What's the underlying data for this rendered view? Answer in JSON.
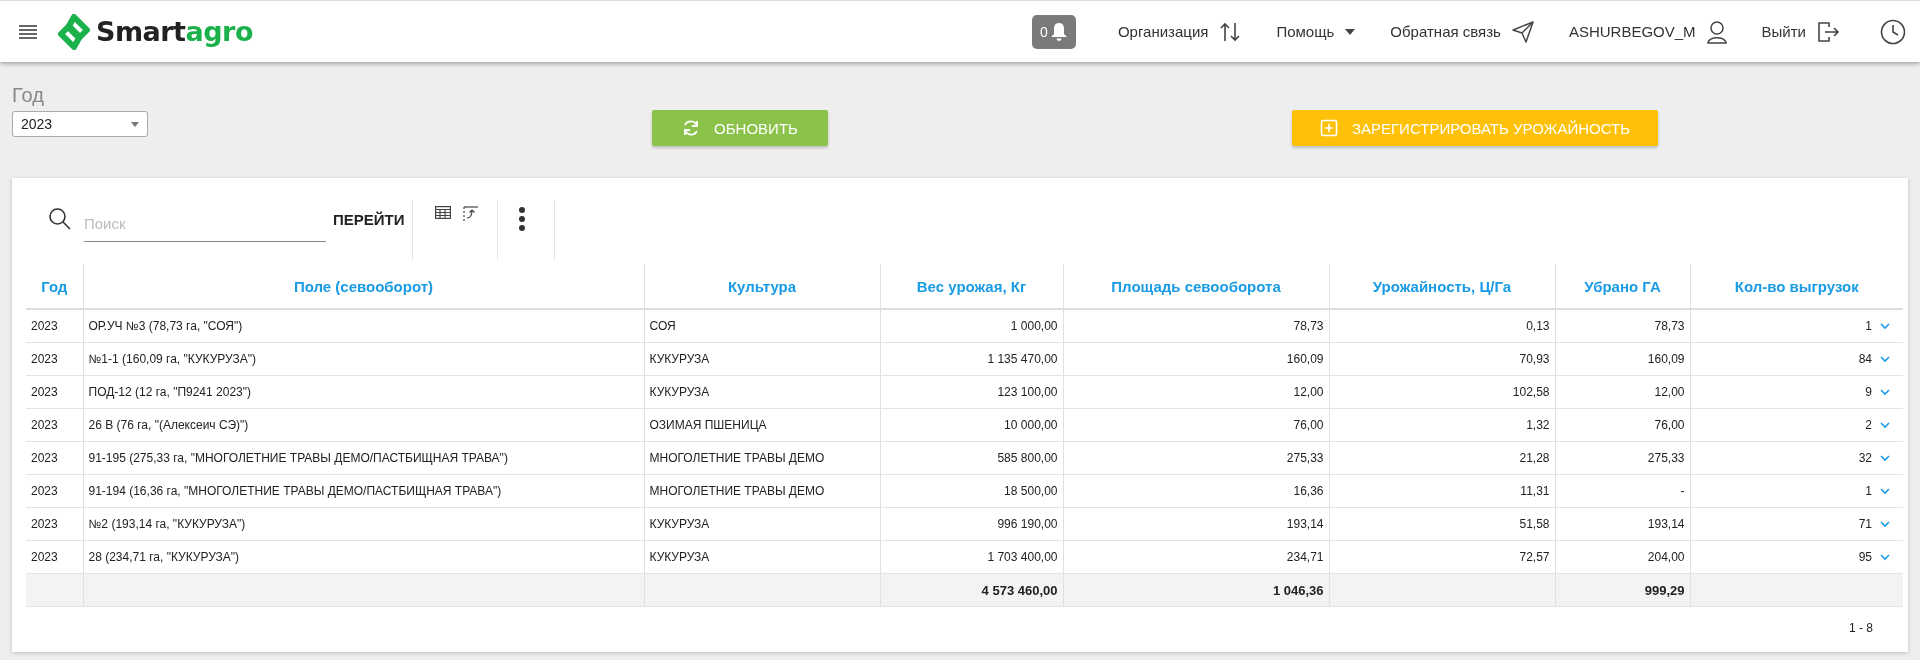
{
  "header": {
    "logo": [
      "Smart",
      "agro"
    ],
    "notifications": "0",
    "nav": [
      {
        "label": "Организация",
        "kind": "swap"
      },
      {
        "label": "Помощь",
        "kind": "dropdown"
      },
      {
        "label": "Обратная связь",
        "kind": "send"
      },
      {
        "label": "ASHURBEGOV_M",
        "kind": "user"
      },
      {
        "label": "Выйти",
        "kind": "logout"
      }
    ]
  },
  "filter": {
    "label": "Год",
    "value": "2023"
  },
  "actions": [
    {
      "label": "ОБНОВИТЬ",
      "kind": "refresh"
    },
    {
      "label": "ЗАРЕГИСТРИРОВАТЬ УРОЖАЙНОСТЬ",
      "kind": "register"
    }
  ],
  "toolbar": {
    "search": {
      "placeholder": "Поиск"
    },
    "go_button": "ПЕРЕЙТИ"
  },
  "table": {
    "columns": [
      "Год",
      "Поле (севооборот)",
      "Культура",
      "Вес урожая, Кг",
      "Площадь севооборота",
      "Урожайность, Ц/Га",
      "Убрано ГА",
      "Кол-во выгрузок"
    ],
    "rows": [
      [
        "2023",
        "ОР.УЧ №3 (78,73 га, \"СОЯ\")",
        "СОЯ",
        "1 000,00",
        "78,73",
        "0,13",
        "78,73",
        "1"
      ],
      [
        "2023",
        "№1-1 (160,09 га, \"КУКУРУЗА\")",
        "КУКУРУЗА",
        "1 135 470,00",
        "160,09",
        "70,93",
        "160,09",
        "84"
      ],
      [
        "2023",
        "ПОД-12 (12 га, \"П9241 2023\")",
        "КУКУРУЗА",
        "123 100,00",
        "12,00",
        "102,58",
        "12,00",
        "9"
      ],
      [
        "2023",
        "26 В (76 га, \"(Алексеич СЭ)\")",
        "ОЗИМАЯ ПШЕНИЦА",
        "10 000,00",
        "76,00",
        "1,32",
        "76,00",
        "2"
      ],
      [
        "2023",
        "91-195 (275,33 га, \"МНОГОЛЕТНИЕ ТРАВЫ ДЕМО/ПАСТБИЩНАЯ ТРАВА\")",
        "МНОГОЛЕТНИЕ ТРАВЫ ДЕМО",
        "585 800,00",
        "275,33",
        "21,28",
        "275,33",
        "32"
      ],
      [
        "2023",
        "91-194 (16,36 га, \"МНОГОЛЕТНИЕ ТРАВЫ ДЕМО/ПАСТБИЩНАЯ ТРАВА\")",
        "МНОГОЛЕТНИЕ ТРАВЫ ДЕМО",
        "18 500,00",
        "16,36",
        "11,31",
        "-",
        "1"
      ],
      [
        "2023",
        "№2 (193,14 га, \"КУКУРУЗА\")",
        "КУКУРУЗА",
        "996 190,00",
        "193,14",
        "51,58",
        "193,14",
        "71"
      ],
      [
        "2023",
        "28 (234,71 га, \"КУКУРУЗА\")",
        "КУКУРУЗА",
        "1 703 400,00",
        "234,71",
        "72,57",
        "204,00",
        "95"
      ]
    ],
    "totals": {
      "harvest_weight": "4 573 460,00",
      "rotation_area": "1 046,36",
      "harvested_area": "999,29"
    }
  },
  "pagination": "1 - 8"
}
